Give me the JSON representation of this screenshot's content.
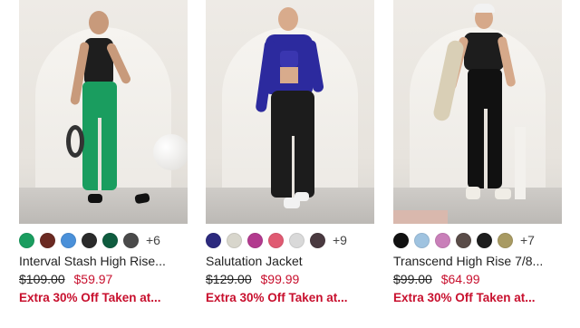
{
  "products": [
    {
      "name": "Interval Stash High Rise...",
      "original_price": "$109.00",
      "sale_price": "$59.97",
      "promo": "Extra 30% Off Taken at...",
      "more_colors": "+6",
      "swatches": [
        "#1a9d5f",
        "#6b2a22",
        "#4a90d9",
        "#2b2b2b",
        "#0f5c3f",
        "#4a4a4a"
      ],
      "image_alt": "Woman in black tank and green leggings holding a ring"
    },
    {
      "name": "Salutation Jacket",
      "original_price": "$129.00",
      "sale_price": "$99.99",
      "promo": "Extra 30% Off Taken at...",
      "more_colors": "+9",
      "swatches": [
        "#2c2a7e",
        "#d8d6cc",
        "#b23a8e",
        "#e05a72",
        "#d9d9d9",
        "#4a3a40"
      ],
      "image_alt": "Woman in blue jacket and black joggers"
    },
    {
      "name": "Transcend High Rise 7/8...",
      "original_price": "$99.00",
      "sale_price": "$64.99",
      "promo": "Extra 30% Off Taken at...",
      "more_colors": "+7",
      "swatches": [
        "#111111",
        "#9fc3e0",
        "#c97fb9",
        "#5a4c48",
        "#1d1d1d",
        "#a89a62"
      ],
      "image_alt": "Woman in black top and black leggings with yoga mat"
    }
  ]
}
